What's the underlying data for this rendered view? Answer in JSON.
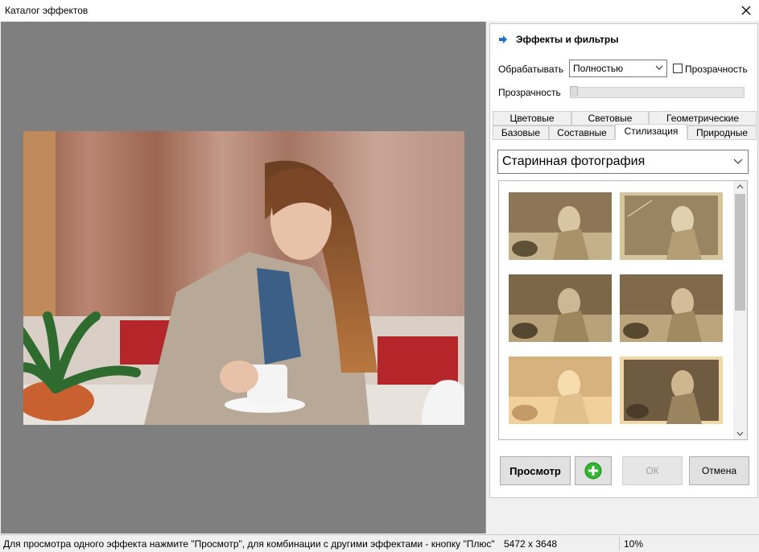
{
  "window": {
    "title": "Каталог эффектов"
  },
  "panel": {
    "header": "Эффекты и фильтры",
    "process_label": "Обрабатывать",
    "process_value": "Полностью",
    "transparency_checkbox_label": "Прозрачность",
    "transparency_checked": false,
    "transparency_slider_label": "Прозрачность",
    "transparency_level": 0
  },
  "tabs": {
    "row_back": [
      "Цветовые",
      "Световые",
      "Геометрические"
    ],
    "row_front": [
      "Базовые",
      "Составные",
      "Стилизация",
      "Природные"
    ],
    "active": "Стилизация"
  },
  "effect_select": {
    "value": "Старинная фотография"
  },
  "buttons": {
    "preview": "Просмотр",
    "ok": "ОК",
    "cancel": "Отмена"
  },
  "status": {
    "hint": "Для просмотра одного эффекта нажмите \"Просмотр\", для комбинации с другими эффектами - кнопку \"Плюс\"",
    "resolution": "5472 x 3648",
    "zoom": "10%"
  },
  "colors": {
    "accent_blue": "#1e6fd9",
    "plus_green": "#2db82d",
    "preview_bg": "#7f7f7f"
  }
}
